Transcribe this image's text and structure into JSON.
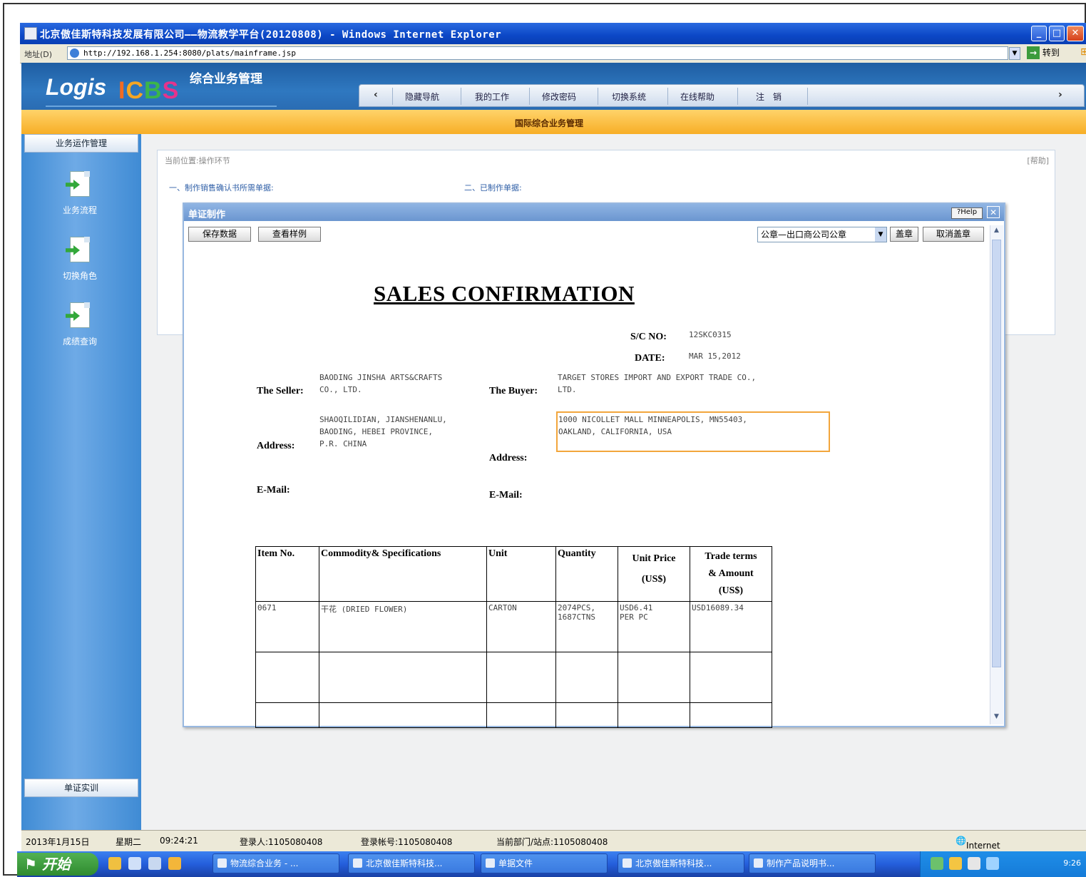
{
  "window": {
    "title": "北京傲佳斯特科技发展有限公司——物流教学平台(20120808) - Windows Internet Explorer",
    "address_label": "地址(D)",
    "url": "http://192.168.1.254:8080/plats/mainframe.jsp",
    "go_label": "转到"
  },
  "app": {
    "logo_logis": "Logis",
    "logo_icbs": [
      "I",
      "C",
      "B",
      "S"
    ],
    "subtitle": "综合业务管理",
    "nav": [
      "隐藏导航",
      "我的工作",
      "修改密码",
      "切换系统",
      "在线帮助",
      "注　销"
    ],
    "band_title": "国际综合业务管理"
  },
  "sidebar": {
    "top_header": "业务运作管理",
    "items": [
      {
        "label": "业务流程",
        "icon": "document-arrow-icon"
      },
      {
        "label": "切换角色",
        "icon": "document-arrow-icon"
      },
      {
        "label": "成绩查询",
        "icon": "document-arrow-icon"
      }
    ],
    "bottom_header": "单证实训"
  },
  "panel": {
    "location": "当前位置:操作环节",
    "help": "[帮助]",
    "section1": "一、制作销售确认书所需单据:",
    "section2": "二、已制作单据:"
  },
  "dialog": {
    "title": "单证制作",
    "help_btn": "?Help",
    "buttons": {
      "save": "保存数据",
      "view_sample": "查看样例"
    },
    "seal_select": "公章—出口商公司公章",
    "stamp_btn": "盖章",
    "cancel_stamp_btn": "取消盖章"
  },
  "document": {
    "title": "SALES CONFIRMATION",
    "sc_no_label": "S/C NO:",
    "sc_no": "12SKC0315",
    "date_label": "DATE:",
    "date": "MAR 15,2012",
    "seller_label": "The Seller:",
    "seller": "BAODING JINSHA ARTS&CRAFTS\nCO., LTD.",
    "buyer_label": "The Buyer:",
    "buyer": "TARGET STORES IMPORT AND EXPORT TRADE CO.,\nLTD.",
    "seller_addr_label": "Address:",
    "seller_addr": "SHAOQILIDIAN, JIANSHENANLU,\nBAODING, HEBEI PROVINCE,\nP.R. CHINA",
    "buyer_addr_label": "Address:",
    "buyer_addr": "1000 NICOLLET MALL MINNEAPOLIS, MN55403,\nOAKLAND, CALIFORNIA, USA",
    "seller_email_label": "E-Mail:",
    "buyer_email_label": "E-Mail:",
    "table": {
      "headers": [
        "Item No.",
        "Commodity& Specifications",
        "Unit",
        "Quantity",
        "Unit Price\n(US$)",
        "Trade terms\n& Amount\n(US$)"
      ],
      "rows": [
        [
          "0671",
          "干花 (DRIED FLOWER)",
          "CARTON",
          "2074PCS,\n1687CTNS",
          "USD6.41\nPER PC",
          "USD16089.34"
        ]
      ]
    }
  },
  "status": {
    "date": "2013年1月15日",
    "weekday": "星期二",
    "time": "09:24:21",
    "login_user": "登录人:1105080408",
    "login_account": "登录帐号:1105080408",
    "dept": "当前部门/站点:1105080408",
    "zone": "Internet"
  },
  "taskbar": {
    "start": "开始",
    "items": [
      "物流综合业务 - ...",
      "北京傲佳斯特科技...",
      "单据文件",
      "北京傲佳斯特科技...",
      "制作产品说明书..."
    ],
    "clock": "9:26"
  }
}
